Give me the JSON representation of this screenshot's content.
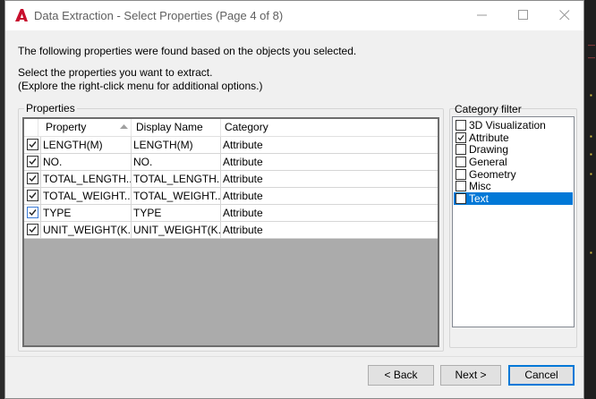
{
  "window": {
    "title": "Data Extraction - Select Properties (Page 4 of 8)"
  },
  "intro": {
    "line1": "The following properties were found based on the objects you selected.",
    "line2": "Select the properties you want to extract.",
    "line3": "(Explore the right-click menu for additional options.)"
  },
  "properties": {
    "group_label": "Properties",
    "columns": [
      "Property",
      "Display Name",
      "Category"
    ],
    "rows": [
      {
        "checked": true,
        "property": "LENGTH(M)",
        "display": "LENGTH(M)",
        "category": "Attribute"
      },
      {
        "checked": true,
        "property": "NO.",
        "display": "NO.",
        "category": "Attribute"
      },
      {
        "checked": true,
        "property": "TOTAL_LENGTH...",
        "display": "TOTAL_LENGTH...",
        "category": "Attribute"
      },
      {
        "checked": true,
        "property": "TOTAL_WEIGHT...",
        "display": "TOTAL_WEIGHT...",
        "category": "Attribute"
      },
      {
        "checked": true,
        "property": "TYPE",
        "display": "TYPE",
        "category": "Attribute"
      },
      {
        "checked": true,
        "property": "UNIT_WEIGHT(K...",
        "display": "UNIT_WEIGHT(K...",
        "category": "Attribute"
      }
    ]
  },
  "category_filter": {
    "label": "Category filter",
    "items": [
      {
        "label": "3D Visualization",
        "checked": false,
        "selected": false
      },
      {
        "label": "Attribute",
        "checked": true,
        "selected": false
      },
      {
        "label": "Drawing",
        "checked": false,
        "selected": false
      },
      {
        "label": "General",
        "checked": false,
        "selected": false
      },
      {
        "label": "Geometry",
        "checked": false,
        "selected": false
      },
      {
        "label": "Misc",
        "checked": false,
        "selected": false
      },
      {
        "label": "Text",
        "checked": false,
        "selected": true
      }
    ]
  },
  "buttons": {
    "back": "< Back",
    "next": "Next >",
    "cancel": "Cancel"
  },
  "colors": {
    "accent": "#0078d7",
    "logo_red": "#c8102e",
    "grid_empty": "#ababab"
  }
}
